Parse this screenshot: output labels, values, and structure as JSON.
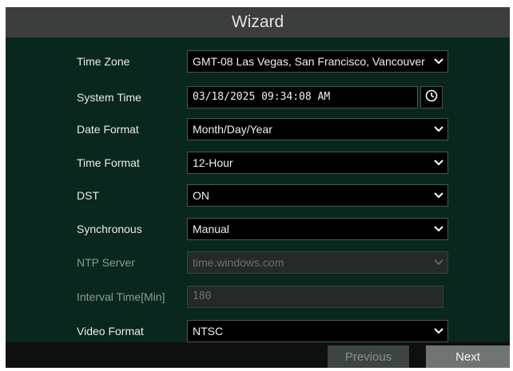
{
  "window": {
    "title": "Wizard"
  },
  "fields": [
    {
      "id": "time_zone",
      "label": "Time Zone",
      "value": "GMT-08 Las Vegas, San Francisco, Vancouver",
      "type": "select",
      "enabled": true
    },
    {
      "id": "system_time",
      "label": "System Time",
      "value": "03/18/2025 09:34:08 AM",
      "type": "datetime",
      "enabled": true,
      "button_icon": "clock-icon"
    },
    {
      "id": "date_format",
      "label": "Date Format",
      "value": "Month/Day/Year",
      "type": "select",
      "enabled": true
    },
    {
      "id": "time_format",
      "label": "Time Format",
      "value": "12-Hour",
      "type": "select",
      "enabled": true
    },
    {
      "id": "dst",
      "label": "DST",
      "value": "ON",
      "type": "select",
      "enabled": true
    },
    {
      "id": "synchronous",
      "label": "Synchronous",
      "value": "Manual",
      "type": "select",
      "enabled": true
    },
    {
      "id": "ntp_server",
      "label": "NTP Server",
      "value": "",
      "placeholder": "time.windows.com",
      "type": "select",
      "enabled": false
    },
    {
      "id": "interval_time",
      "label": "Interval Time[Min]",
      "value": "",
      "placeholder": "180",
      "type": "text",
      "enabled": false
    },
    {
      "id": "video_format",
      "label": "Video Format",
      "value": "NTSC",
      "type": "select",
      "enabled": true
    }
  ],
  "footer": {
    "previous_label": "Previous",
    "next_label": "Next"
  },
  "colors": {
    "background": "#09271e",
    "header": "#3c3e3e",
    "footer": "#0e0f0f",
    "field": "#000000",
    "next_button": "#6f7471",
    "previous_button": "#3e4441"
  }
}
